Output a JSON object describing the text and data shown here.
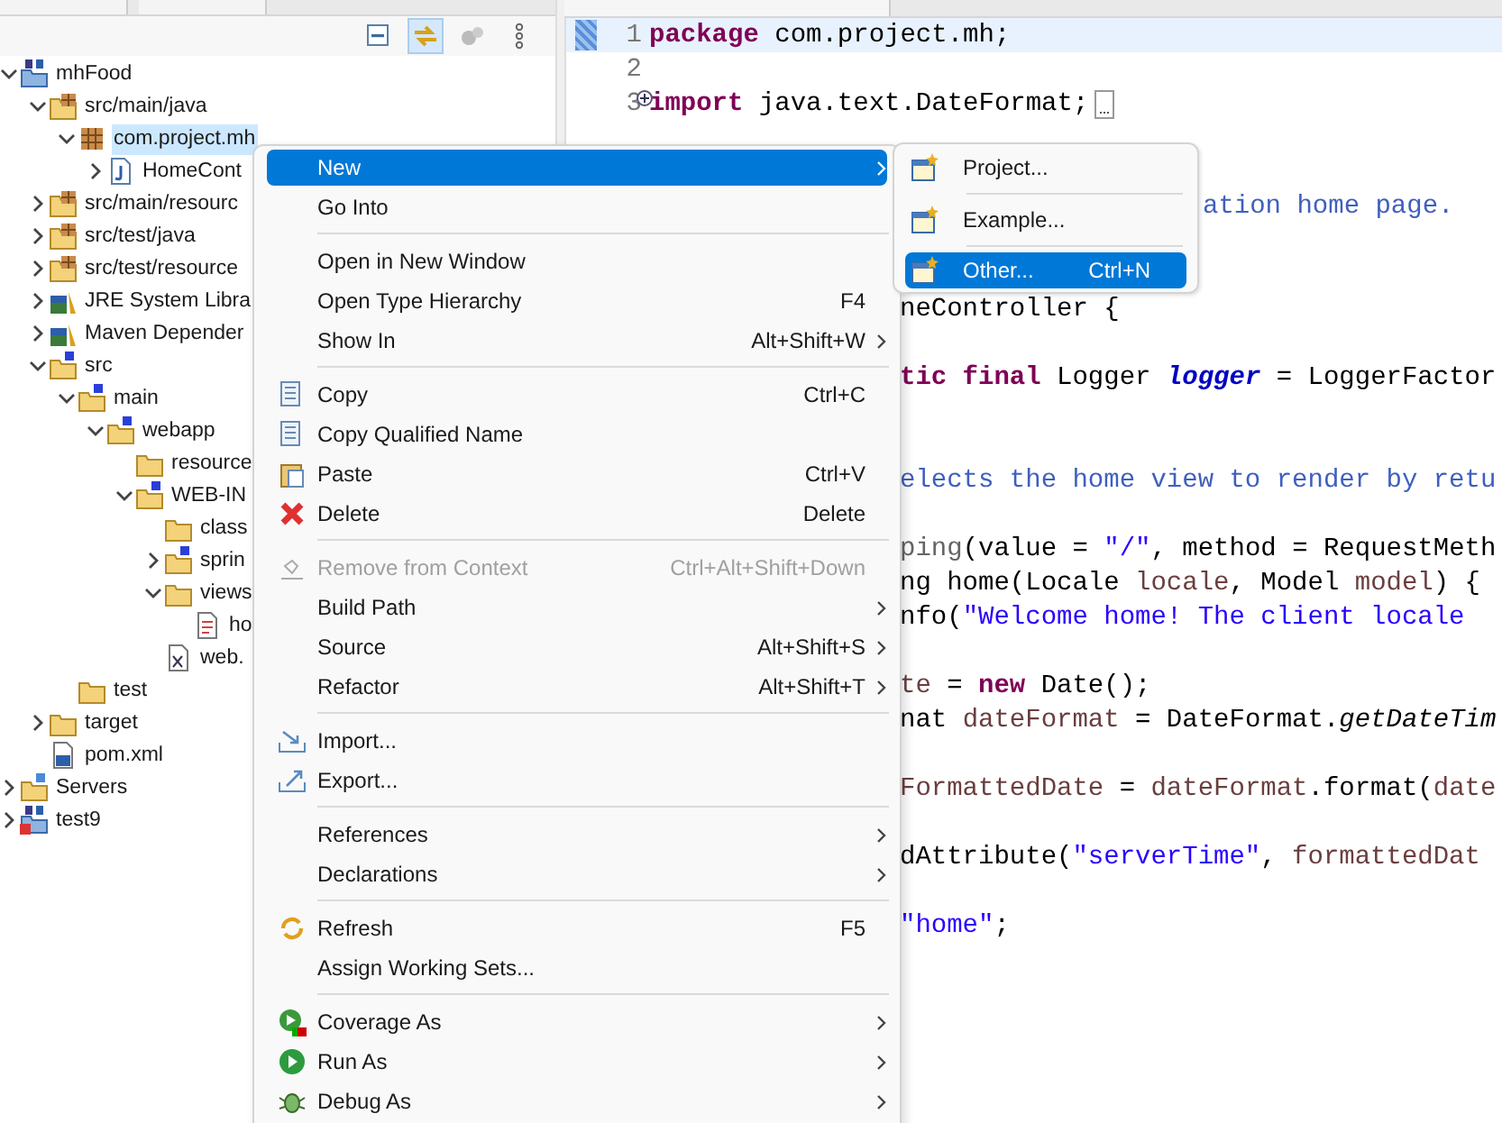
{
  "explorer": {
    "toolbar": [
      {
        "selected": false
      },
      {
        "selected": true
      },
      {
        "selected": false
      },
      {
        "selected": false
      }
    ],
    "tree": [
      {
        "label": "mhFood",
        "kind": "maven-project",
        "expanded": true,
        "selected": false,
        "children": [
          {
            "label": "src/main/java",
            "kind": "source-folder",
            "expanded": true,
            "selected": false,
            "children": [
              {
                "label": "com.project.mh",
                "kind": "package",
                "expanded": true,
                "selected": true,
                "children": [
                  {
                    "label": "HomeCont",
                    "kind": "java-file",
                    "expanded": false,
                    "selected": false
                  }
                ]
              }
            ]
          },
          {
            "label": "src/main/resourc",
            "kind": "source-folder",
            "expanded": false,
            "selected": false
          },
          {
            "label": "src/test/java",
            "kind": "source-folder",
            "expanded": false,
            "selected": false
          },
          {
            "label": "src/test/resource",
            "kind": "source-folder",
            "expanded": false,
            "selected": false
          },
          {
            "label": "JRE System Libra",
            "kind": "library",
            "expanded": false,
            "selected": false
          },
          {
            "label": "Maven Depender",
            "kind": "library",
            "expanded": false,
            "selected": false
          },
          {
            "label": "src",
            "kind": "web-folder",
            "expanded": true,
            "selected": false,
            "children": [
              {
                "label": "main",
                "kind": "web-folder",
                "expanded": true,
                "selected": false,
                "children": [
                  {
                    "label": "webapp",
                    "kind": "web-folder",
                    "expanded": true,
                    "selected": false,
                    "children": [
                      {
                        "label": "resource",
                        "kind": "folder",
                        "selected": false
                      },
                      {
                        "label": "WEB-IN",
                        "kind": "web-folder",
                        "expanded": true,
                        "selected": false,
                        "children": [
                          {
                            "label": "class",
                            "kind": "folder",
                            "selected": false
                          },
                          {
                            "label": "sprin",
                            "kind": "web-folder",
                            "expanded": false,
                            "selected": false
                          },
                          {
                            "label": "views",
                            "kind": "folder",
                            "expanded": true,
                            "selected": false,
                            "children": [
                              {
                                "label": "ho",
                                "kind": "jsp-file",
                                "selected": false
                              }
                            ]
                          },
                          {
                            "label": "web.",
                            "kind": "xml-file",
                            "selected": false
                          }
                        ]
                      }
                    ]
                  }
                ]
              },
              {
                "label": "test",
                "kind": "folder",
                "selected": false
              }
            ]
          },
          {
            "label": "target",
            "kind": "folder",
            "expanded": false,
            "selected": false
          },
          {
            "label": "pom.xml",
            "kind": "maven-pom",
            "selected": false
          }
        ]
      },
      {
        "label": "Servers",
        "kind": "server-folder",
        "expanded": false,
        "selected": false
      },
      {
        "label": "test9",
        "kind": "error-project",
        "expanded": false,
        "selected": false
      }
    ]
  },
  "editor": {
    "lines": [
      {
        "number": "1",
        "current": true,
        "segments": [
          {
            "text": "package",
            "kind": "keyword"
          },
          {
            "text": " com.project.mh;",
            "kind": "plain"
          }
        ]
      },
      {
        "number": "2",
        "current": false
      },
      {
        "number": "3",
        "current": false,
        "folded": true,
        "segments": [
          {
            "text": "import",
            "kind": "keyword"
          },
          {
            "text": " java.text.DateFormat;",
            "kind": "plain"
          }
        ]
      },
      {
        "current": false
      },
      {
        "current": false
      },
      {
        "current": false,
        "segments": [
          {
            "text": "ation home page.",
            "kind": "comment"
          }
        ]
      },
      {
        "current": false
      },
      {
        "current": false
      },
      {
        "current": false,
        "segments": [
          {
            "text": "neController {",
            "kind": "plain"
          }
        ]
      },
      {
        "current": false
      },
      {
        "current": false,
        "segments": [
          {
            "text": "tic final",
            "kind": "keyword"
          },
          {
            "text": " Logger ",
            "kind": "plain"
          },
          {
            "text": "logger",
            "kind": "field"
          },
          {
            "text": " = LoggerFactor",
            "kind": "plain"
          }
        ]
      },
      {
        "current": false
      },
      {
        "current": false
      },
      {
        "current": false,
        "segments": [
          {
            "text": "elects the home view to render by retu",
            "kind": "comment"
          }
        ]
      },
      {
        "current": false
      },
      {
        "current": false,
        "segments": [
          {
            "text": "ping",
            "kind": "annotation"
          },
          {
            "text": "(value = ",
            "kind": "plain"
          },
          {
            "text": "\"/\"",
            "kind": "string"
          },
          {
            "text": ", method = RequestMeth",
            "kind": "plain"
          }
        ]
      },
      {
        "current": false,
        "segments": [
          {
            "text": "ng home(Locale ",
            "kind": "plain"
          },
          {
            "text": "locale",
            "kind": "variable"
          },
          {
            "text": ", Model ",
            "kind": "plain"
          },
          {
            "text": "model",
            "kind": "variable"
          },
          {
            "text": ") {",
            "kind": "plain"
          }
        ]
      },
      {
        "current": false,
        "segments": [
          {
            "text": "nfo(",
            "kind": "plain"
          },
          {
            "text": "\"Welcome home! The client locale ",
            "kind": "string"
          }
        ]
      },
      {
        "current": false
      },
      {
        "current": false,
        "segments": [
          {
            "text": "te",
            "kind": "variable"
          },
          {
            "text": " = ",
            "kind": "plain"
          },
          {
            "text": "new",
            "kind": "keyword"
          },
          {
            "text": " Date();",
            "kind": "plain"
          }
        ]
      },
      {
        "current": false,
        "segments": [
          {
            "text": "nat ",
            "kind": "plain"
          },
          {
            "text": "dateFormat",
            "kind": "variable"
          },
          {
            "text": " = DateFormat.",
            "kind": "plain"
          },
          {
            "text": "getDateTim",
            "kind": "static-method"
          }
        ]
      },
      {
        "current": false
      },
      {
        "current": false,
        "segments": [
          {
            "text": "FormattedDate",
            "kind": "variable"
          },
          {
            "text": " = ",
            "kind": "plain"
          },
          {
            "text": "dateFormat",
            "kind": "variable"
          },
          {
            "text": ".format(",
            "kind": "plain"
          },
          {
            "text": "date",
            "kind": "variable"
          }
        ]
      },
      {
        "current": false
      },
      {
        "current": false,
        "segments": [
          {
            "text": "dAttribute(",
            "kind": "plain"
          },
          {
            "text": "\"serverTime\"",
            "kind": "string"
          },
          {
            "text": ", ",
            "kind": "plain"
          },
          {
            "text": "formattedDat",
            "kind": "variable"
          }
        ]
      },
      {
        "current": false
      },
      {
        "current": false,
        "segments": [
          {
            "text": "\"home\"",
            "kind": "string"
          },
          {
            "text": ";",
            "kind": "plain"
          }
        ]
      }
    ]
  },
  "context_menu": {
    "items": [
      {
        "kind": "item",
        "label": "New",
        "has_submenu": true,
        "selected": true,
        "disabled": false
      },
      {
        "kind": "item",
        "label": "Go Into",
        "has_submenu": false,
        "selected": false,
        "disabled": false
      },
      {
        "kind": "separator"
      },
      {
        "kind": "item",
        "label": "Open in New Window",
        "has_submenu": false,
        "selected": false,
        "disabled": false
      },
      {
        "kind": "item",
        "label": "Open Type Hierarchy",
        "shortcut": "F4",
        "has_submenu": false,
        "selected": false,
        "disabled": false
      },
      {
        "kind": "item",
        "label": "Show In",
        "shortcut": "Alt+Shift+W",
        "has_submenu": true,
        "selected": false,
        "disabled": false
      },
      {
        "kind": "separator"
      },
      {
        "kind": "item",
        "label": "Copy",
        "shortcut": "Ctrl+C",
        "has_submenu": false,
        "selected": false,
        "disabled": false
      },
      {
        "kind": "item",
        "label": "Copy Qualified Name",
        "has_submenu": false,
        "selected": false,
        "disabled": false
      },
      {
        "kind": "item",
        "label": "Paste",
        "shortcut": "Ctrl+V",
        "has_submenu": false,
        "selected": false,
        "disabled": false
      },
      {
        "kind": "item",
        "label": "Delete",
        "shortcut": "Delete",
        "has_submenu": false,
        "selected": false,
        "disabled": false
      },
      {
        "kind": "separator"
      },
      {
        "kind": "item",
        "label": "Remove from Context",
        "shortcut": "Ctrl+Alt+Shift+Down",
        "has_submenu": false,
        "selected": false,
        "disabled": true
      },
      {
        "kind": "item",
        "label": "Build Path",
        "has_submenu": true,
        "selected": false,
        "disabled": false
      },
      {
        "kind": "item",
        "label": "Source",
        "shortcut": "Alt+Shift+S",
        "has_submenu": true,
        "selected": false,
        "disabled": false
      },
      {
        "kind": "item",
        "label": "Refactor",
        "shortcut": "Alt+Shift+T",
        "has_submenu": true,
        "selected": false,
        "disabled": false
      },
      {
        "kind": "separator"
      },
      {
        "kind": "item",
        "label": "Import...",
        "has_submenu": false,
        "selected": false,
        "disabled": false
      },
      {
        "kind": "item",
        "label": "Export...",
        "has_submenu": false,
        "selected": false,
        "disabled": false
      },
      {
        "kind": "separator"
      },
      {
        "kind": "item",
        "label": "References",
        "has_submenu": true,
        "selected": false,
        "disabled": false
      },
      {
        "kind": "item",
        "label": "Declarations",
        "has_submenu": true,
        "selected": false,
        "disabled": false
      },
      {
        "kind": "separator"
      },
      {
        "kind": "item",
        "label": "Refresh",
        "shortcut": "F5",
        "has_submenu": false,
        "selected": false,
        "disabled": false
      },
      {
        "kind": "item",
        "label": "Assign Working Sets...",
        "has_submenu": false,
        "selected": false,
        "disabled": false
      },
      {
        "kind": "separator"
      },
      {
        "kind": "item",
        "label": "Coverage As",
        "has_submenu": true,
        "selected": false,
        "disabled": false
      },
      {
        "kind": "item",
        "label": "Run As",
        "has_submenu": true,
        "selected": false,
        "disabled": false
      },
      {
        "kind": "item",
        "label": "Debug As",
        "has_submenu": true,
        "selected": false,
        "disabled": false
      }
    ]
  },
  "submenu": {
    "items": [
      {
        "kind": "item",
        "label": "Project...",
        "selected": false
      },
      {
        "kind": "separator"
      },
      {
        "kind": "item",
        "label": "Example...",
        "selected": false
      },
      {
        "kind": "separator"
      },
      {
        "kind": "item",
        "label": "Other...",
        "shortcut": "Ctrl+N",
        "selected": true
      }
    ]
  }
}
